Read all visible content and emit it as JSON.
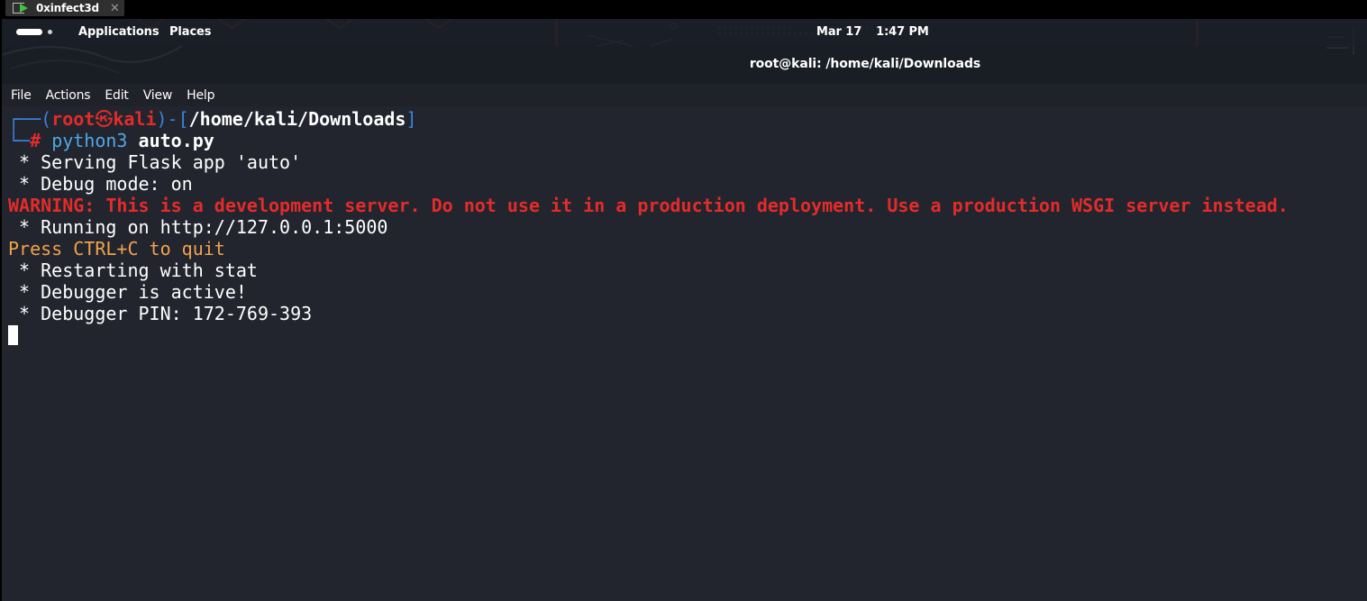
{
  "host": {
    "tab_title": "0xinfect3d",
    "close_glyph": "✕"
  },
  "topbar": {
    "applications": "Applications",
    "places": "Places",
    "date": "Mar 17",
    "time": "1:47 PM"
  },
  "window": {
    "title": "root@kali: /home/kali/Downloads"
  },
  "menu": [
    "File",
    "Actions",
    "Edit",
    "View",
    "Help"
  ],
  "terminal": {
    "prompt": {
      "user": "root",
      "symbol": "㉿",
      "host": "kali",
      "path": "/home/kali/Downloads",
      "hash": "#",
      "command": "python3",
      "argument": "auto.py"
    },
    "lines": {
      "serving": " * Serving Flask app 'auto'",
      "debug": " * Debug mode: on",
      "warning": "WARNING: This is a development server. Do not use it in a production deployment. Use a production WSGI server instead.",
      "running": " * Running on http://127.0.0.1:5000",
      "quit": "Press CTRL+C to quit",
      "restart": " * Restarting with stat",
      "debugger_active": " * Debugger is active!",
      "debugger_pin": " * Debugger PIN: 172-769-393"
    }
  },
  "colors": {
    "terminal_bg": "#22252d",
    "prompt_blue": "#3a81e2",
    "prompt_red": "#e42b2b",
    "warning_red": "#e42b2b",
    "quit_orange": "#f1a24d",
    "command_cyan": "#4fa7e4"
  }
}
